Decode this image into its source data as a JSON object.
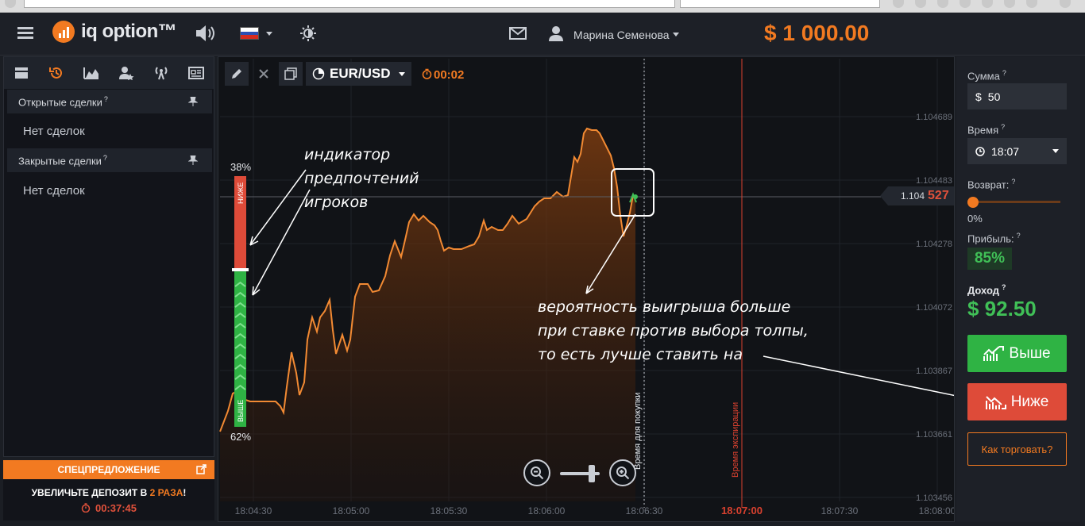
{
  "header": {
    "logo_text": "iq option™",
    "user_name": "Марина Семенова",
    "balance": "$ 1 000.00"
  },
  "left_panel": {
    "open_deals_title": "Открытые сделки",
    "open_deals_empty": "Нет сделок",
    "closed_deals_title": "Закрытые сделки",
    "closed_deals_empty": "Нет сделок",
    "help_mark": "?"
  },
  "promo": {
    "title": "СПЕЦПРЕДЛОЖЕНИЕ",
    "text_prefix": "УВЕЛИЧЬТЕ ДЕПОЗИТ В ",
    "text_highlight": "2 РАЗА",
    "text_suffix": "!",
    "timer": "00:37:45"
  },
  "chart_toolbar": {
    "asset": "EUR/USD",
    "timer": "00:02"
  },
  "crowd_indicator": {
    "top_percent": "38%",
    "bottom_percent": "62%",
    "top_label": "НИЖЕ",
    "bottom_label": "ВЫШЕ",
    "lower_fraction": 0.38
  },
  "annotations": {
    "indicator_note": [
      "индикатор",
      "предпочтений",
      "игроков"
    ],
    "probability_note": [
      "вероятность выигрыша больше",
      "при ставке против выбора толпы,",
      "то есть лучше ставить на"
    ]
  },
  "chart": {
    "purchase_time_label": "Время для покупки",
    "expiration_label": "Время экспирации",
    "current_price_prefix": "1.104",
    "current_price_suffix": "527",
    "y_ticks": [
      "1.104689",
      "1.104483",
      "1.104278",
      "1.104072",
      "1.103867",
      "1.103661",
      "1.103456"
    ],
    "x_ticks": [
      "18:04:30",
      "18:05:00",
      "18:05:30",
      "18:06:00",
      "18:06:30",
      "18:07:00",
      "18:07:30",
      "18:08:00"
    ],
    "highlighted_x_tick": "18:07:00",
    "colors": {
      "line": "#f28a33",
      "expiration": "#d9412f",
      "up": "#2fb344",
      "down": "#de4b39"
    }
  },
  "right_panel": {
    "amount_label": "Сумма",
    "amount_currency": "$",
    "amount_value": "50",
    "time_label": "Время",
    "time_value": "18:07",
    "return_label": "Возврат:",
    "return_value": "0%",
    "profit_label": "Прибыль:",
    "profit_value": "85%",
    "income_label": "Доход",
    "income_value": "$ 92.50",
    "up_button": "Выше",
    "down_button": "Ниже",
    "how_button": "Как торговать?"
  }
}
